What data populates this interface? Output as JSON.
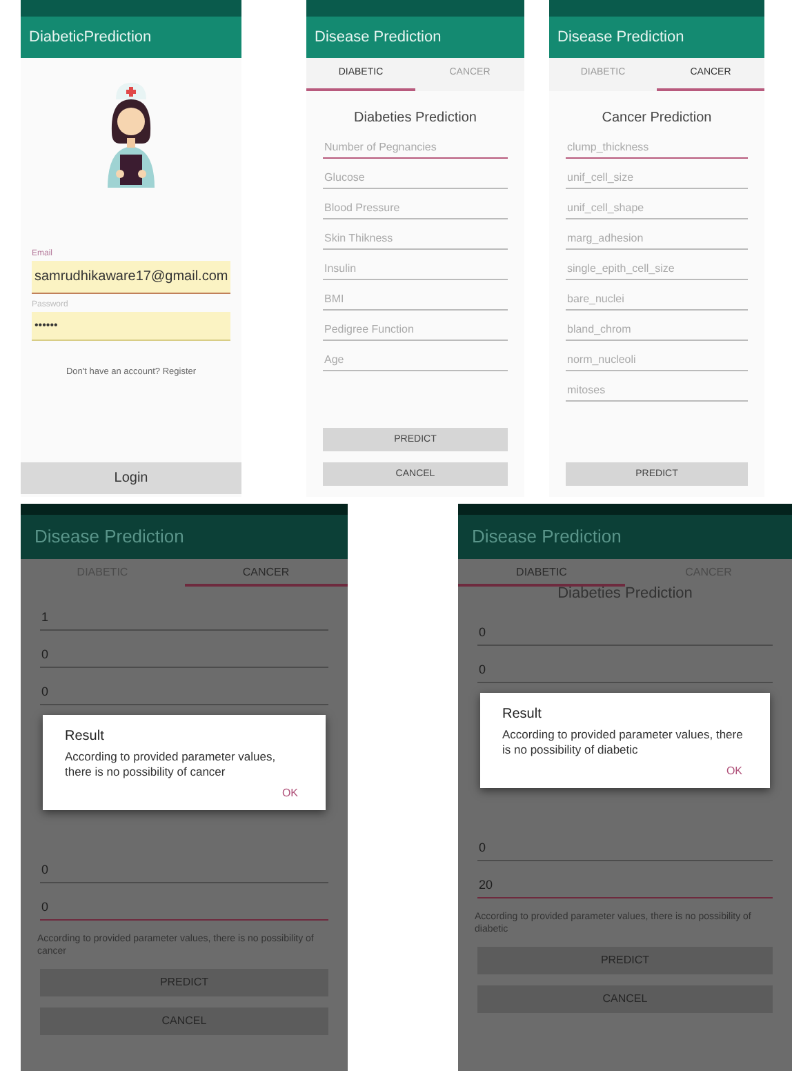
{
  "screens": [
    {
      "kind": "login",
      "title": "DiabeticPrediction",
      "email": {
        "label": "Email",
        "value": "samrudhikaware17@gmail.com",
        "focused": true
      },
      "password": {
        "label": "Password",
        "value": "••••••",
        "focused": false
      },
      "register_text": "Don't have an account? Register",
      "login_button": "Login"
    },
    {
      "kind": "form",
      "title": "Disease Prediction",
      "tabs": [
        {
          "label": "DIABETIC",
          "selected": true
        },
        {
          "label": "CANCER",
          "selected": false
        }
      ],
      "heading": "Diabeties Prediction",
      "fields": [
        {
          "placeholder": "Number of Pegnancies",
          "focused": true
        },
        {
          "placeholder": "Glucose",
          "focused": false
        },
        {
          "placeholder": "Blood Pressure",
          "focused": false
        },
        {
          "placeholder": "Skin Thikness",
          "focused": false
        },
        {
          "placeholder": "Insulin",
          "focused": false
        },
        {
          "placeholder": "BMI",
          "focused": false
        },
        {
          "placeholder": "Pedigree Function",
          "focused": false
        },
        {
          "placeholder": "Age",
          "focused": false
        }
      ],
      "buttons": [
        "PREDICT",
        "CANCEL"
      ]
    },
    {
      "kind": "form",
      "title": "Disease Prediction",
      "tabs": [
        {
          "label": "DIABETIC",
          "selected": false
        },
        {
          "label": "CANCER",
          "selected": true
        }
      ],
      "heading": "Cancer Prediction",
      "fields": [
        {
          "placeholder": "clump_thickness",
          "focused": true
        },
        {
          "placeholder": "unif_cell_size",
          "focused": false
        },
        {
          "placeholder": "unif_cell_shape",
          "focused": false
        },
        {
          "placeholder": "marg_adhesion",
          "focused": false
        },
        {
          "placeholder": "single_epith_cell_size",
          "focused": false
        },
        {
          "placeholder": "bare_nuclei",
          "focused": false
        },
        {
          "placeholder": "bland_chrom",
          "focused": false
        },
        {
          "placeholder": "norm_nucleoli",
          "focused": false
        },
        {
          "placeholder": "mitoses",
          "focused": false
        }
      ],
      "buttons": [
        "PREDICT"
      ]
    },
    {
      "kind": "result",
      "title": "Disease Prediction",
      "tabs": [
        {
          "label": "DIABETIC",
          "selected": false
        },
        {
          "label": "CANCER",
          "selected": true
        }
      ],
      "fields": [
        {
          "value": "1",
          "focused": false
        },
        {
          "value": "0",
          "focused": false
        },
        {
          "value": "0",
          "focused": false
        }
      ],
      "fields_below": [
        {
          "value": "0",
          "focused": false
        },
        {
          "value": "0",
          "focused": true
        }
      ],
      "result_text": "According to provided parameter values, there is no possibility of cancer",
      "buttons": [
        "PREDICT",
        "CANCEL"
      ],
      "dialog": {
        "title": "Result",
        "message": "According to provided parameter values, there is no possibility of cancer",
        "button": "OK"
      }
    },
    {
      "kind": "result",
      "title": "Disease Prediction",
      "tabs": [
        {
          "label": "DIABETIC",
          "selected": true
        },
        {
          "label": "CANCER",
          "selected": false
        }
      ],
      "heading": "Diabeties Prediction",
      "fields": [
        {
          "value": "0",
          "focused": false
        },
        {
          "value": "0",
          "focused": false
        }
      ],
      "fields_below": [
        {
          "value": "0",
          "focused": false
        },
        {
          "value": "20",
          "focused": true
        }
      ],
      "result_text": "According to provided parameter values, there is no possibility of diabetic",
      "buttons": [
        "PREDICT",
        "CANCEL"
      ],
      "dialog": {
        "title": "Result",
        "message": "According to provided parameter values, there is no possibility of diabetic",
        "button": "OK"
      }
    }
  ]
}
